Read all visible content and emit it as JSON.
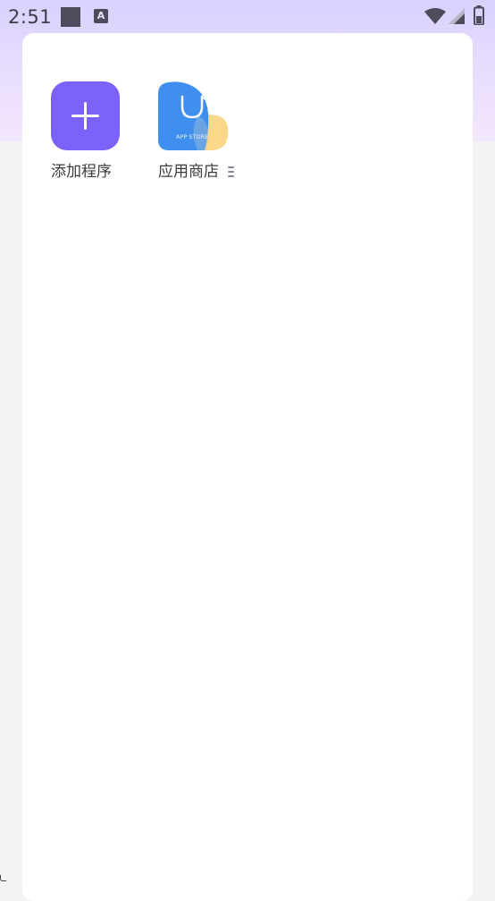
{
  "status_bar": {
    "time": "2:51",
    "notification_icons": [
      "square-notification-icon",
      "a-notification-icon"
    ],
    "right_icons": [
      "wifi-icon",
      "signal-icon",
      "battery-icon"
    ]
  },
  "apps": [
    {
      "label": "添加程序",
      "icon": "plus-icon",
      "color": "#7a63fb"
    },
    {
      "label": "应用商店",
      "icon": "app-store-icon",
      "icon_text": "APP STORE",
      "colors": [
        "#3e8ff0",
        "#fbd78a"
      ]
    }
  ],
  "colors": {
    "header_gradient_start": "#d9d1ff",
    "header_gradient_end": "#f3e6fb",
    "card_background": "#ffffff",
    "page_background": "#f3f3f4"
  }
}
